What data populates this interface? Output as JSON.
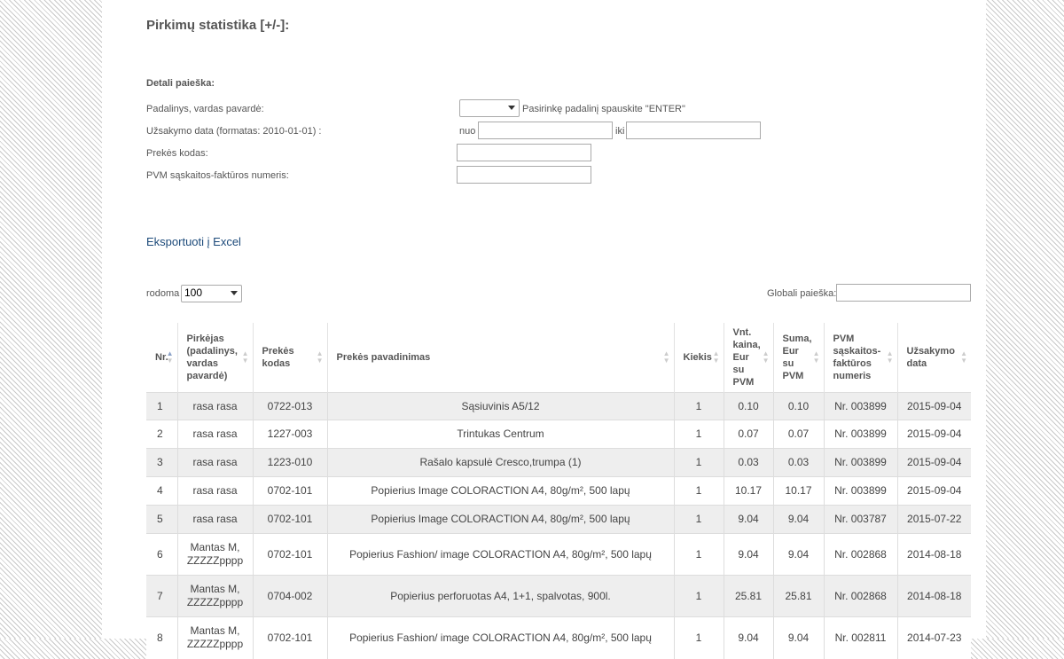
{
  "page": {
    "title": "Pirkimų statistika [+/-]:",
    "detail_title": "Detali paieška:"
  },
  "filters": {
    "division_label": "Padalinys, vardas pavardė:",
    "division_hint": "Pasirinkę padalinį spauskite \"ENTER\"",
    "division_selected": "",
    "date_label": "Užsakymo data (formatas: 2010-01-01) :",
    "date_from_label": "nuo",
    "date_to_label": "iki",
    "date_from_value": "",
    "date_to_value": "",
    "product_code_label": "Prekės kodas:",
    "product_code_value": "",
    "invoice_label": "PVM sąskaitos-faktūros numeris:",
    "invoice_value": ""
  },
  "export": {
    "label": "Eksportuoti į Excel"
  },
  "table_controls": {
    "show_label": "rodoma",
    "show_value": "100",
    "search_label": "Globali paieška:",
    "search_value": ""
  },
  "table": {
    "columns": [
      "Nr.",
      "Pirkėjas (padalinys, vardas pavardė)",
      "Prekės kodas",
      "Prekės pavadinimas",
      "Kiekis",
      "Vnt. kaina, Eur su PVM",
      "Suma, Eur su PVM",
      "PVM sąskaitos-faktūros numeris",
      "Užsakymo data"
    ],
    "rows": [
      [
        "1",
        "rasa rasa",
        "0722-013",
        "Sąsiuvinis A5/12",
        "1",
        "0.10",
        "0.10",
        "Nr. 003899",
        "2015-09-04"
      ],
      [
        "2",
        "rasa rasa",
        "1227-003",
        "Trintukas Centrum",
        "1",
        "0.07",
        "0.07",
        "Nr. 003899",
        "2015-09-04"
      ],
      [
        "3",
        "rasa rasa",
        "1223-010",
        "Rašalo kapsulė Cresco,trumpa (1)",
        "1",
        "0.03",
        "0.03",
        "Nr. 003899",
        "2015-09-04"
      ],
      [
        "4",
        "rasa rasa",
        "0702-101",
        "Popierius Image COLORACTION A4, 80g/m², 500 lapų",
        "1",
        "10.17",
        "10.17",
        "Nr. 003899",
        "2015-09-04"
      ],
      [
        "5",
        "rasa rasa",
        "0702-101",
        "Popierius Image COLORACTION A4, 80g/m², 500 lapų",
        "1",
        "9.04",
        "9.04",
        "Nr. 003787",
        "2015-07-22"
      ],
      [
        "6",
        "Mantas M, ZZZZZpppp",
        "0702-101",
        "Popierius Fashion/ image COLORACTION A4, 80g/m², 500 lapų",
        "1",
        "9.04",
        "9.04",
        "Nr. 002868",
        "2014-08-18"
      ],
      [
        "7",
        "Mantas M, ZZZZZpppp",
        "0704-002",
        "Popierius perforuotas A4, 1+1, spalvotas, 900l.",
        "1",
        "25.81",
        "25.81",
        "Nr. 002868",
        "2014-08-18"
      ],
      [
        "8",
        "Mantas M, ZZZZZpppp",
        "0702-101",
        "Popierius Fashion/ image COLORACTION A4, 80g/m², 500 lapų",
        "1",
        "9.04",
        "9.04",
        "Nr. 002811",
        "2014-07-23"
      ]
    ]
  }
}
